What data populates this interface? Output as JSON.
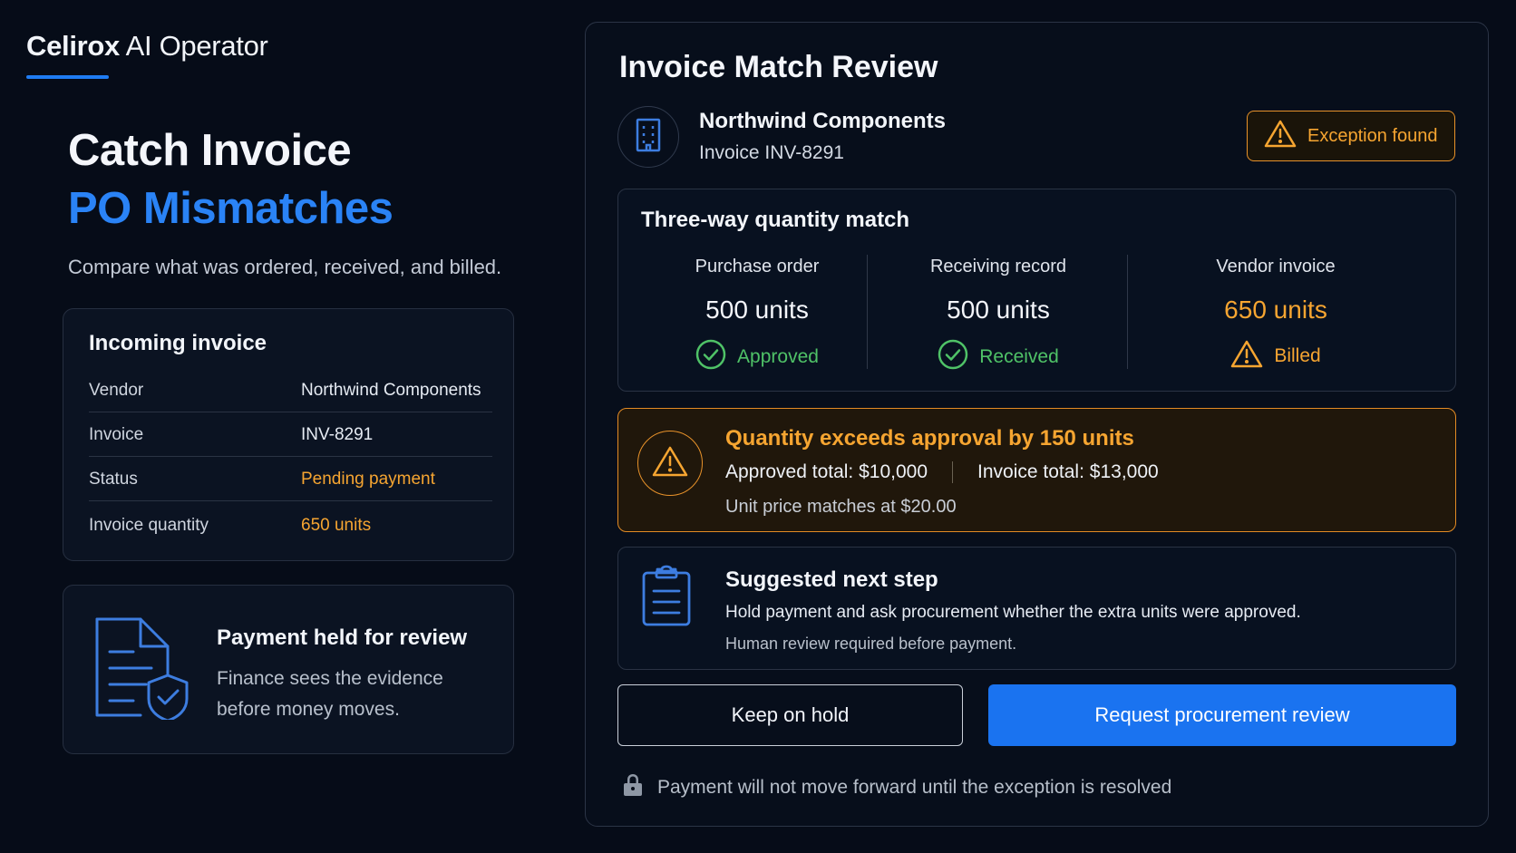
{
  "brand": {
    "name_bold": "Celirox",
    "name_rest": " AI Operator"
  },
  "hero": {
    "line1": "Catch Invoice",
    "line2": "PO Mismatches",
    "subtitle": "Compare what was ordered, received, and billed."
  },
  "incoming_invoice": {
    "title": "Incoming invoice",
    "rows": [
      {
        "label": "Vendor",
        "value": "Northwind Components"
      },
      {
        "label": "Invoice",
        "value": "INV-8291"
      },
      {
        "label": "Status",
        "value": "Pending payment"
      },
      {
        "label": "Invoice quantity",
        "value": "650 units"
      }
    ]
  },
  "held_card": {
    "title": "Payment held for review",
    "description": "Finance sees the evidence before money moves.",
    "icon": "document-shield-icon"
  },
  "review": {
    "title": "Invoice Match Review",
    "vendor_name": "Northwind Components",
    "invoice_label": "Invoice INV-8291",
    "vendor_icon": "building-icon",
    "exception_badge": "Exception found"
  },
  "three_way_match": {
    "title": "Three-way quantity match",
    "columns": [
      {
        "label": "Purchase order",
        "quantity": "500 units",
        "status": "Approved",
        "status_icon": "check-circle-icon",
        "state": "ok"
      },
      {
        "label": "Receiving record",
        "quantity": "500 units",
        "status": "Received",
        "status_icon": "check-circle-icon",
        "state": "ok"
      },
      {
        "label": "Vendor invoice",
        "quantity": "650 units",
        "status": "Billed",
        "status_icon": "warning-icon",
        "state": "warn"
      }
    ]
  },
  "alert": {
    "title": "Quantity exceeds approval by 150 units",
    "approved_label": "Approved total:",
    "approved_value": "$10,000",
    "invoice_label": "Invoice total:",
    "invoice_value": "$13,000",
    "unit_price_note": "Unit price matches at $20.00"
  },
  "next_step": {
    "title": "Suggested next step",
    "description": "Hold payment and ask procurement whether the extra units were approved.",
    "note": "Human review required before payment.",
    "icon": "clipboard-icon"
  },
  "actions": {
    "hold_label": "Keep on hold",
    "request_label": "Request procurement review"
  },
  "footnote": {
    "text": "Payment will not move forward until the exception is resolved",
    "icon": "lock-icon"
  },
  "colors": {
    "accent_blue": "#1a73f0",
    "warning_orange": "#f6a531",
    "success_green": "#4fc267",
    "background": "#060c18"
  }
}
